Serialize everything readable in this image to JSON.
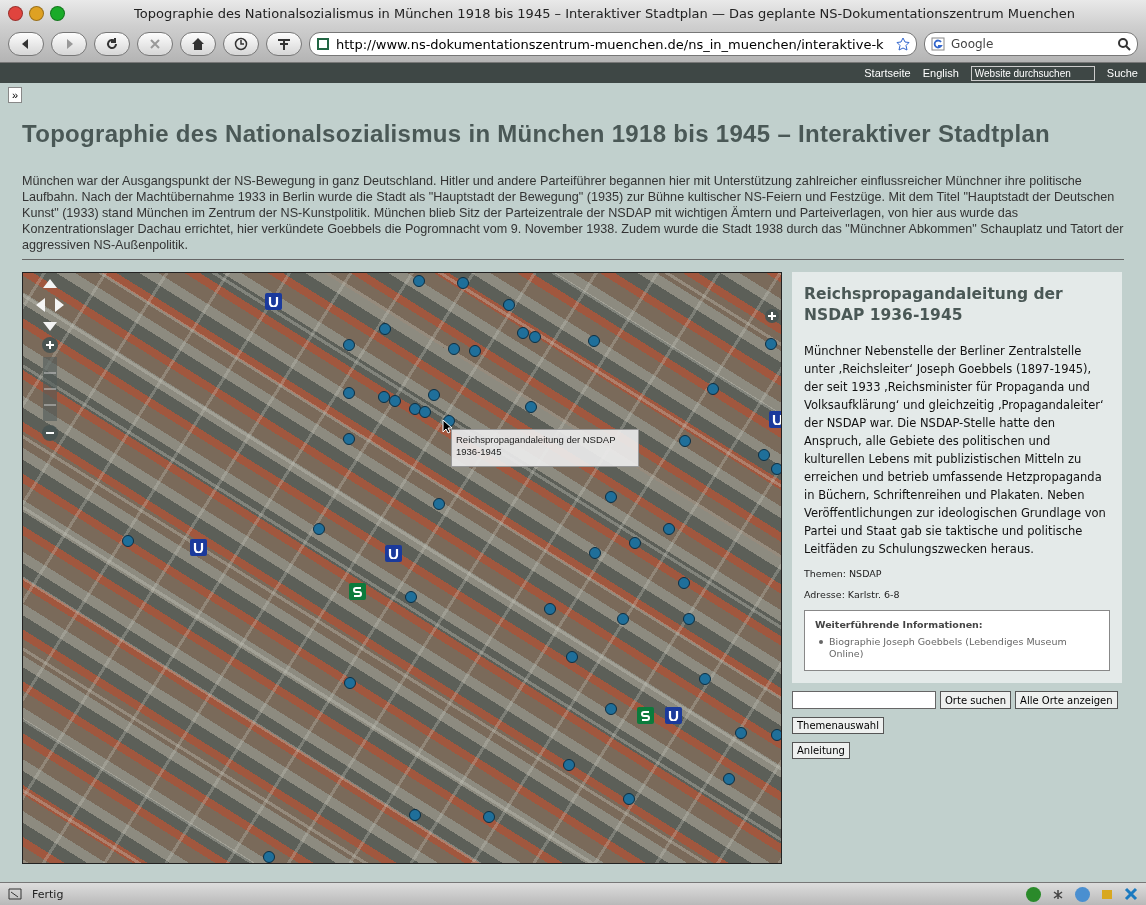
{
  "window": {
    "title": "Topographie des Nationalsozialismus in München 1918 bis 1945 – Interaktiver Stadtplan — Das geplante NS-Dokumentationszentrum Muenchen"
  },
  "toolbar": {
    "url": "http://www.ns-dokumentationszentrum-muenchen.de/ns_in_muenchen/interaktive-k",
    "search_placeholder": "Google"
  },
  "site_nav": {
    "links": [
      "Startseite",
      "English"
    ],
    "search_placeholder": "Website durchsuchen",
    "search_button": "Suche"
  },
  "sidebar_toggle": "»",
  "page": {
    "title": "Topographie des Nationalsozialismus in München 1918 bis 1945 – Interaktiver Stadtplan",
    "intro": "München war der Ausgangspunkt der NS-Bewegung in ganz Deutschland. Hitler und andere Parteiführer begannen hier mit Unterstützung zahlreicher einflussreicher Münchner ihre politische Laufbahn. Nach der Machtübernahme 1933 in Berlin wurde die Stadt als \"Hauptstadt der Bewegung\" (1935) zur Bühne kultischer NS-Feiern und Festzüge. Mit dem Titel \"Hauptstadt der Deutschen Kunst\" (1933) stand München im Zentrum der NS-Kunstpolitik. München blieb Sitz der Parteizentrale der NSDAP mit wichtigen Ämtern und Parteiverlagen, von hier aus wurde das Konzentrationslager Dachau errichtet, hier verkündete Goebbels die Pogromnacht vom 9. November 1938. Zudem wurde die Stadt 1938 durch das \"Münchner Abkommen\" Schauplatz und Tatort der aggressiven NS-Außenpolitik."
  },
  "map": {
    "tooltip": [
      "Reichspropagandaleitung der NSDAP",
      "1936-1945"
    ]
  },
  "detail": {
    "title": "Reichspropagandaleitung der NSDAP 1936-1945",
    "body": "Münchner Nebenstelle der Berliner Zentralstelle unter ‚Reichsleiter‘ Joseph Goebbels (1897-1945), der seit 1933 ‚Reichsminister für Propaganda und Volksaufklärung‘ und gleichzeitig ‚Propagandaleiter‘ der NSDAP war. Die NSDAP-Stelle hatte den Anspruch, alle Gebiete des politischen und kulturellen Lebens mit publizistischen Mitteln zu erreichen und betrieb umfassende Hetzpropaganda in Büchern, Schriftenreihen und Plakaten. Neben Veröffentlichungen zur ideologischen Grundlage von Partei und Staat gab sie taktische und politische Leitfäden zu Schulungszwecken heraus.",
    "meta": [
      "Themen: NSDAP",
      "Adresse: Karlstr. 6-8"
    ],
    "more": {
      "heading": "Weiterführende Informationen:",
      "links": [
        "Biographie Joseph Goebbels (Lebendiges Museum Online)"
      ]
    }
  },
  "controls": {
    "rows": [
      [
        "Orte suchen",
        "Alle Orte anzeigen"
      ],
      [
        "Themenauswahl"
      ],
      [
        "Anleitung"
      ]
    ]
  },
  "status_bar": {
    "text": "Fertig"
  }
}
